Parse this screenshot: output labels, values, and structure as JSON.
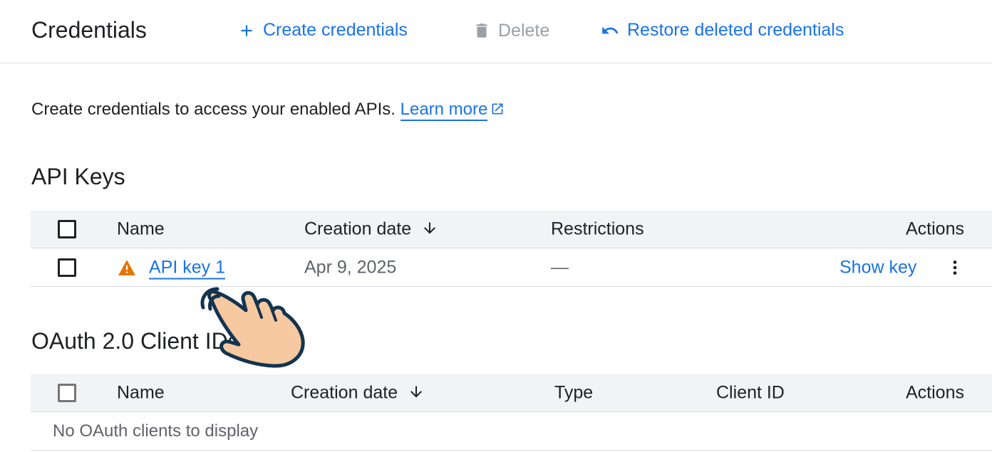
{
  "toolbar": {
    "title": "Credentials",
    "create_label": "Create credentials",
    "delete_label": "Delete",
    "restore_label": "Restore deleted credentials"
  },
  "intro": {
    "text": "Create credentials to access your enabled APIs.",
    "learn_more": "Learn more"
  },
  "api_keys": {
    "title": "API Keys",
    "headers": {
      "name": "Name",
      "creation_date": "Creation date",
      "restrictions": "Restrictions",
      "actions": "Actions"
    },
    "rows": [
      {
        "name": "API key 1",
        "creation_date": "Apr 9, 2025",
        "restrictions": "—",
        "action_label": "Show key"
      }
    ]
  },
  "oauth": {
    "title": "OAuth 2.0 Client IDs",
    "headers": {
      "name": "Name",
      "creation_date": "Creation date",
      "type": "Type",
      "client_id": "Client ID",
      "actions": "Actions"
    },
    "empty_text": "No OAuth clients to display"
  },
  "colors": {
    "accent": "#1a73e8",
    "warning": "#e37400",
    "disabled": "#9aa0a6",
    "header_bg": "#f1f3f4"
  },
  "icons": {
    "create": "plus-icon",
    "delete": "trash-icon",
    "restore": "undo-icon",
    "external": "external-link-icon",
    "sort": "arrow-down-icon",
    "warning": "warning-triangle-icon",
    "more": "more-vert-icon",
    "cursor": "pointing-hand-icon"
  }
}
